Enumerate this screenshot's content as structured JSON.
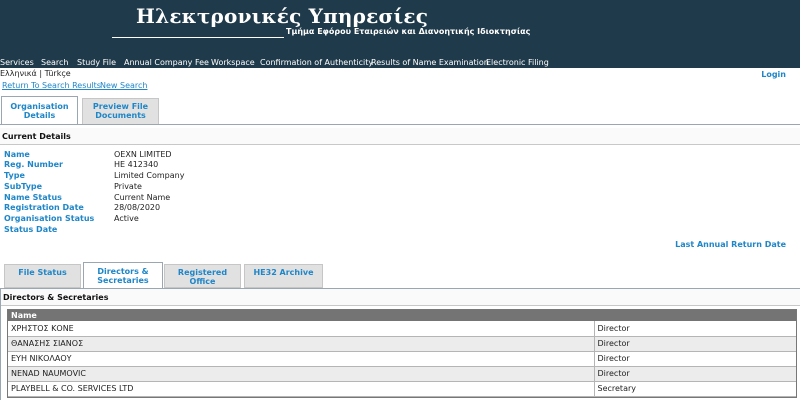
{
  "header": {
    "title": "Ηλεκτρονικές Υπηρεσίες",
    "subtitle": "Τμήμα Εφόρου Εταιρειών και Διανοητικής Ιδιοκτησίας"
  },
  "nav": {
    "items": [
      "Services",
      "Search",
      "Study File",
      "Annual Company Fee",
      "Workspace",
      "Confirmation of Authenticity",
      "Results of Name Examination",
      "Electronic Filing"
    ]
  },
  "lang": {
    "greek": "Ελληνικά",
    "separator": "|",
    "turkish": "Türkçe"
  },
  "login": "Login",
  "links": {
    "return": "Return To Search Results",
    "new_search": "New Search"
  },
  "top_tabs": {
    "org_details": "Organisation Details",
    "preview_line1": "Preview File",
    "preview_line2": "Documents"
  },
  "current_details": {
    "title": "Current Details",
    "labels": [
      "Name",
      "Reg. Number",
      "Type",
      "SubType",
      "Name Status",
      "Registration Date",
      "Organisation Status",
      "Status Date"
    ],
    "values": [
      "OEXN LIMITED",
      "HE 412340",
      "Limited Company",
      "Private",
      "Current Name",
      "28/08/2020",
      "Active",
      ""
    ]
  },
  "last_annual": "Last Annual Return Date",
  "bottom_tabs": [
    "File Status",
    "Directors & Secretaries",
    "Registered Office",
    "HE32 Archive"
  ],
  "directors": {
    "title": "Directors & Secretaries",
    "column_name": "Name",
    "rows": [
      {
        "name": "ΧΡΗΣΤΟΣ ΚΟΝΕ",
        "role": "Director"
      },
      {
        "name": "ΘΑΝΑΣΗΣ ΣΙΑΝΟΣ",
        "role": "Director"
      },
      {
        "name": "ΕΥΗ ΝΙΚΟΛΑΟΥ",
        "role": "Director"
      },
      {
        "name": "NENAD NAUMOVIC",
        "role": "Director"
      },
      {
        "name": "PLAYBELL & CO. SERVICES LTD",
        "role": "Secretary"
      }
    ]
  }
}
